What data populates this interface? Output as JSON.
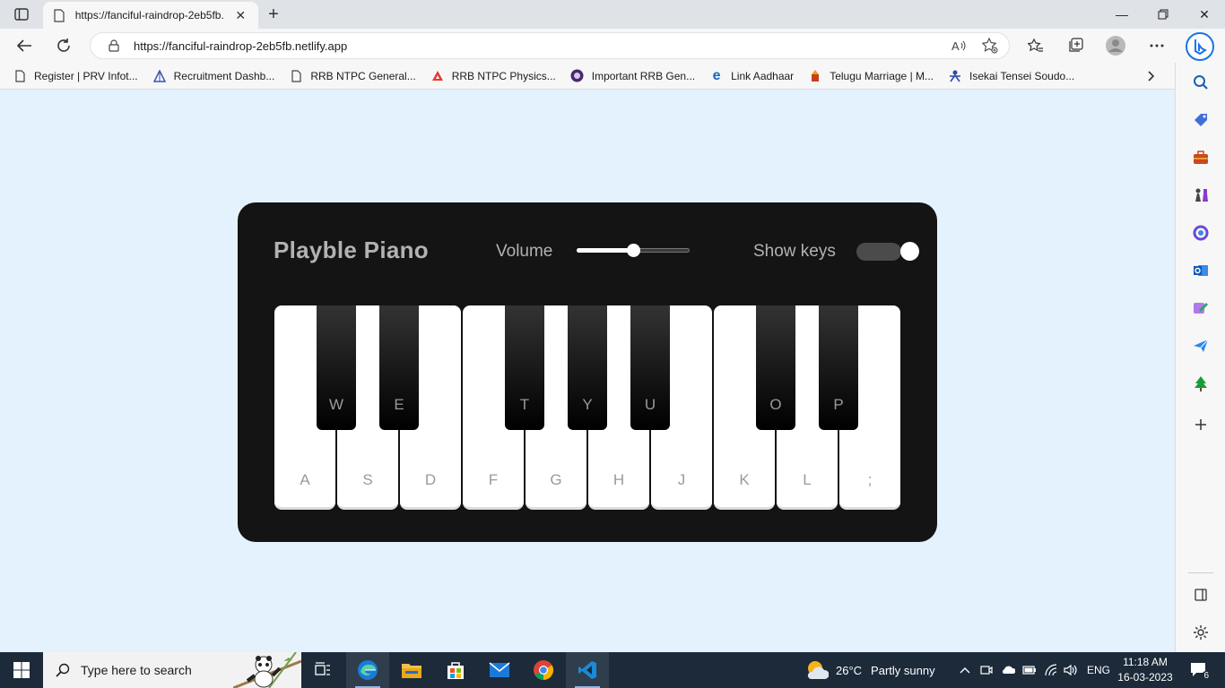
{
  "browser": {
    "tab_title": "https://fanciful-raindrop-2eb5fb.",
    "url": "https://fanciful-raindrop-2eb5fb.netlify.app",
    "bookmarks": [
      {
        "label": "Register | PRV Infot...",
        "icon": "page-icon"
      },
      {
        "label": "Recruitment Dashb...",
        "icon": "triangle-logo-icon"
      },
      {
        "label": "RRB NTPC General...",
        "icon": "page-icon"
      },
      {
        "label": "RRB NTPC Physics...",
        "icon": "red-logo-icon"
      },
      {
        "label": "Important RRB Gen...",
        "icon": "circle-logo-icon"
      },
      {
        "label": "Link Aadhaar",
        "icon": "edge-e-icon"
      },
      {
        "label": "Telugu Marriage | M...",
        "icon": "temple-icon"
      },
      {
        "label": "Isekai Tensei Soudo...",
        "icon": "figure-icon"
      }
    ],
    "sidebar_icons": [
      "search-icon",
      "tag-icon",
      "toolbox-icon",
      "chess-icon",
      "office-icon",
      "outlook-icon",
      "draw-icon",
      "send-icon",
      "tree-icon",
      "add-icon"
    ]
  },
  "piano": {
    "title": "Playble Piano",
    "volume_label": "Volume",
    "volume_level": 0.5,
    "show_keys_label": "Show keys",
    "show_keys_on": true,
    "white_keys": [
      "A",
      "S",
      "D",
      "F",
      "G",
      "H",
      "J",
      "K",
      "L",
      ";"
    ],
    "black_keys": [
      "W",
      "E",
      "T",
      "Y",
      "U",
      "O",
      "P"
    ]
  },
  "taskbar": {
    "search_placeholder": "Type here to search",
    "weather_temp": "26°C",
    "weather_text": "Partly sunny",
    "language": "ENG",
    "time": "11:18 AM",
    "date": "16-03-2023",
    "notification_count": "6"
  },
  "colors": {
    "page_bg": "#e3f2fd",
    "piano_bg": "#141414",
    "label_gray": "#b2b2b2"
  }
}
